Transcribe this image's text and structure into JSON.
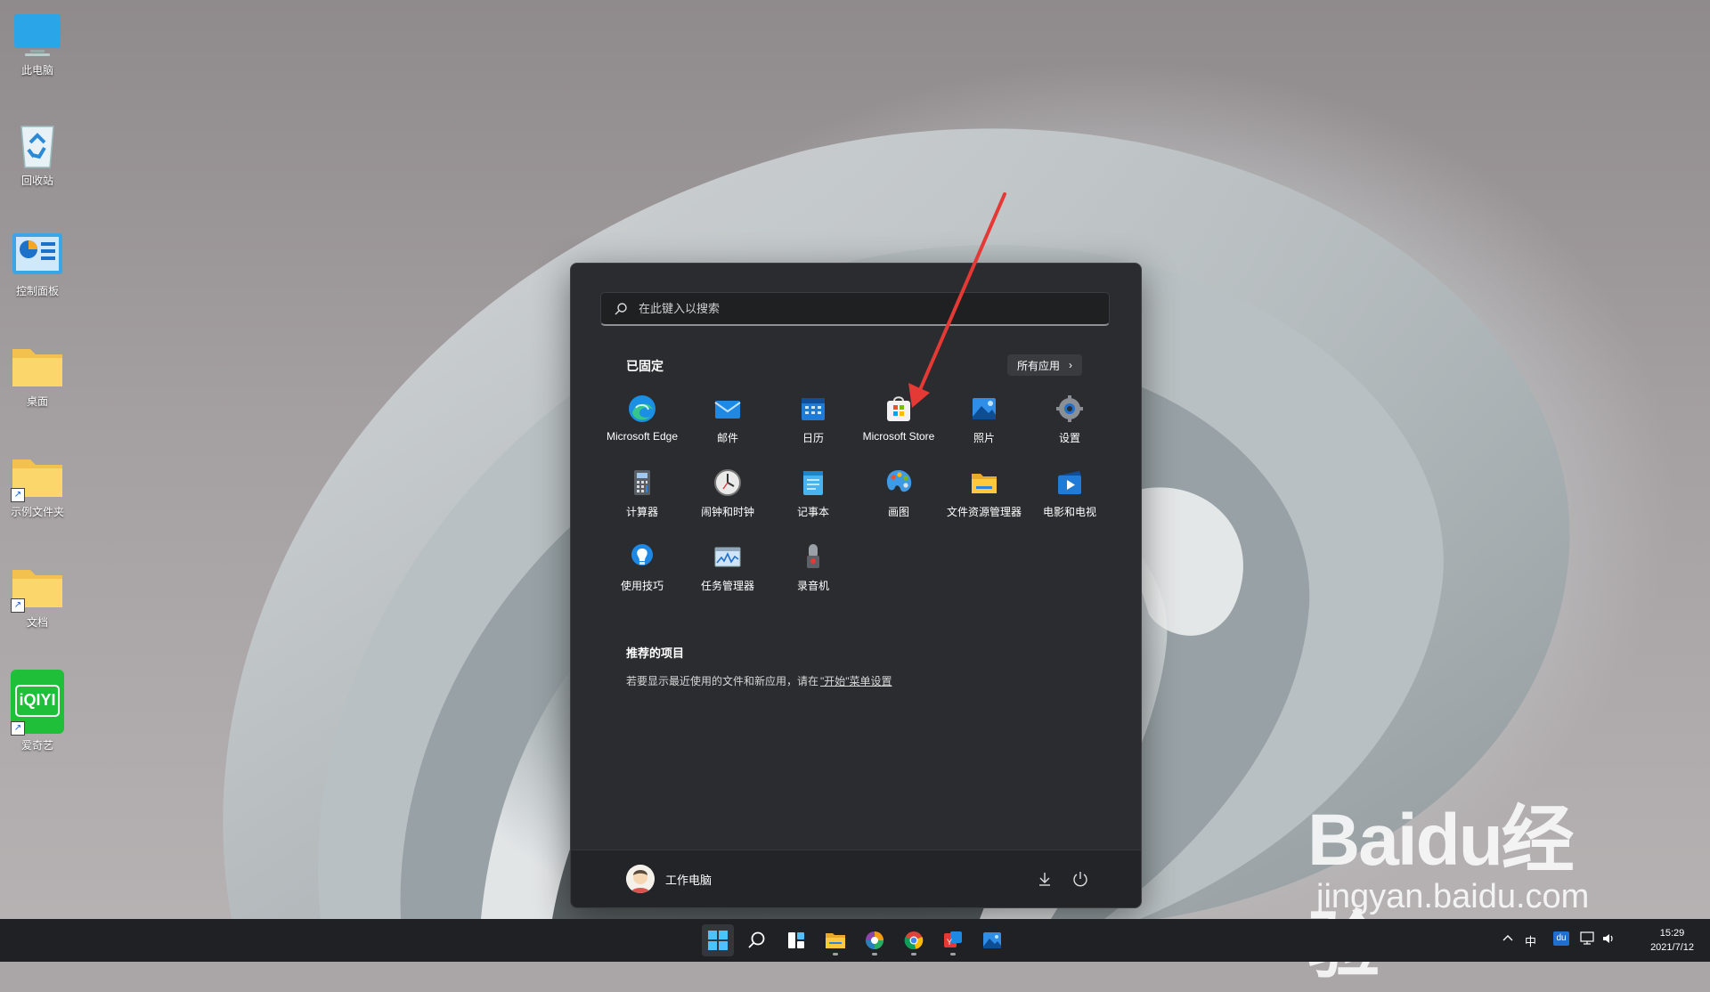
{
  "desktop": {
    "icons": [
      {
        "label": "此电脑",
        "icon": "monitor-icon"
      },
      {
        "label": "回收站",
        "icon": "recycle-bin-icon"
      },
      {
        "label": "控制面板",
        "icon": "control-panel-icon"
      },
      {
        "label": "桌面",
        "icon": "folder-icon"
      },
      {
        "label": "示例文件夹",
        "icon": "folder-shortcut-icon"
      },
      {
        "label": "文档",
        "icon": "folder-shortcut-icon"
      },
      {
        "label": "爱奇艺",
        "icon": "iqiyi-icon",
        "logo_text": "iQIYI"
      }
    ]
  },
  "start_menu": {
    "search_placeholder": "在此键入以搜索",
    "pinned_title": "已固定",
    "all_apps_label": "所有应用",
    "pinned_apps": [
      {
        "label": "Microsoft Edge",
        "icon": "edge-icon"
      },
      {
        "label": "邮件",
        "icon": "mail-icon"
      },
      {
        "label": "日历",
        "icon": "calendar-icon"
      },
      {
        "label": "Microsoft Store",
        "icon": "store-icon"
      },
      {
        "label": "照片",
        "icon": "photos-icon"
      },
      {
        "label": "设置",
        "icon": "settings-icon"
      },
      {
        "label": "计算器",
        "icon": "calculator-icon"
      },
      {
        "label": "闹钟和时钟",
        "icon": "clock-icon"
      },
      {
        "label": "记事本",
        "icon": "notepad-icon"
      },
      {
        "label": "画图",
        "icon": "paint-icon"
      },
      {
        "label": "文件资源管理器",
        "icon": "file-explorer-icon"
      },
      {
        "label": "电影和电视",
        "icon": "movies-icon"
      },
      {
        "label": "使用技巧",
        "icon": "tips-icon"
      },
      {
        "label": "任务管理器",
        "icon": "task-manager-icon"
      },
      {
        "label": "录音机",
        "icon": "recorder-icon"
      }
    ],
    "recommended_title": "推荐的项目",
    "recommended_desc": "若要显示最近使用的文件和新应用，请在",
    "recommended_link": "\"开始\"菜单设置",
    "user_name": "工作电脑"
  },
  "taskbar": {
    "items": [
      "start-icon",
      "search-icon",
      "widgets-icon",
      "file-explorer-icon",
      "browser-icon",
      "chrome-icon",
      "youdao-icon",
      "photos-icon"
    ],
    "tray": {
      "ime": "中",
      "baidu_badge": "du",
      "time": "15:29",
      "date": "2021/7/12"
    }
  },
  "watermark": {
    "brand": "Baidu经验",
    "url": "jingyan.baidu.com"
  },
  "colors": {
    "menu_bg": "#2b2c2f",
    "taskbar_bg": "#1f2125",
    "accent": "#0078d4",
    "annotation_arrow": "#e53935"
  }
}
